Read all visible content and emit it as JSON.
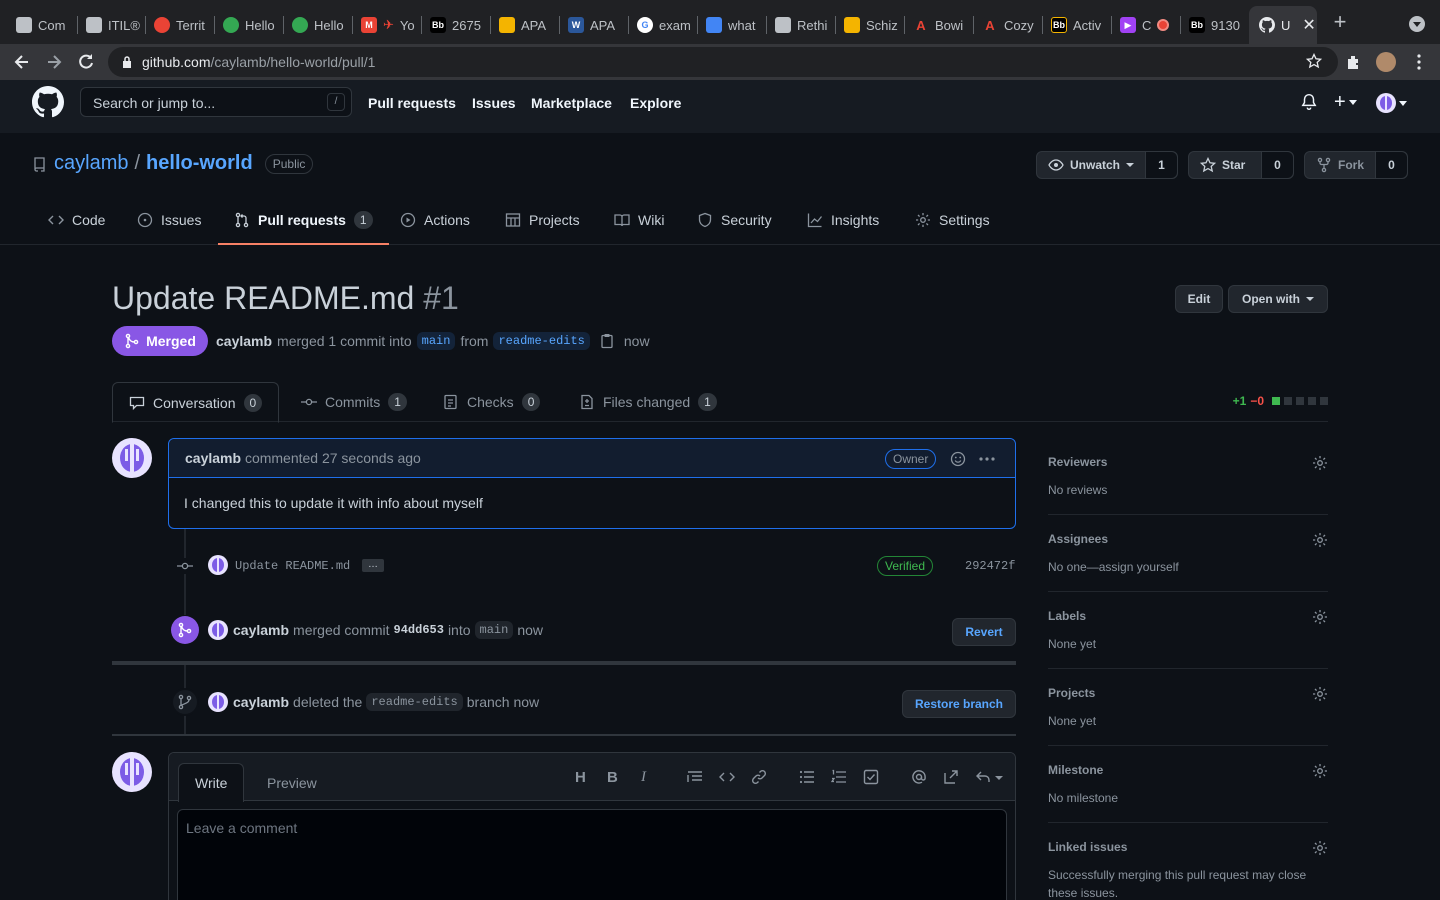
{
  "browser": {
    "tabs": [
      {
        "label": "Com",
        "icon": "github-icon",
        "color": "#bdc1c6"
      },
      {
        "label": "ITIL®",
        "icon": "github-icon",
        "color": "#bdc1c6"
      },
      {
        "label": "Territ",
        "icon": "red-circle-icon",
        "color": "#ea4335"
      },
      {
        "label": "Hello",
        "icon": "green-leaf-icon",
        "color": "#34a853"
      },
      {
        "label": "Hello",
        "icon": "green-leaf-icon",
        "color": "#34a853"
      },
      {
        "label": "Yo",
        "icon": "gmail-icon",
        "color": "#ea4335"
      },
      {
        "label": "2675",
        "icon": "blackboard-icon",
        "color": "#000000"
      },
      {
        "label": "APA",
        "icon": "apa-icon",
        "color": "#f4b400"
      },
      {
        "label": "APA",
        "icon": "word-icon",
        "color": "#2b579a"
      },
      {
        "label": "exam",
        "icon": "google-icon",
        "color": "#ffffff"
      },
      {
        "label": "what",
        "icon": "graduation-icon",
        "color": "#4285f4"
      },
      {
        "label": "Rethi",
        "icon": "github-icon",
        "color": "#bdc1c6"
      },
      {
        "label": "Schiz",
        "icon": "bookmark-icon",
        "color": "#f4b400"
      },
      {
        "label": "Bowi",
        "icon": "red-a-icon",
        "color": "#ea4335"
      },
      {
        "label": "Cozy",
        "icon": "red-a-icon",
        "color": "#ea4335"
      },
      {
        "label": "Activ",
        "icon": "blackboard-icon",
        "color": "#000000"
      },
      {
        "label": "C",
        "icon": "purple-play-icon",
        "color": "#a142f4"
      },
      {
        "label": "9130",
        "icon": "blackboard-icon",
        "color": "#000000"
      },
      {
        "label": "U",
        "icon": "github-icon",
        "color": "#e8eaed"
      }
    ],
    "url_host": "github.com",
    "url_path": "/caylamb/hello-world/pull/1"
  },
  "header": {
    "search_placeholder": "Search or jump to...",
    "search_key": "/",
    "nav": [
      "Pull requests",
      "Issues",
      "Marketplace",
      "Explore"
    ]
  },
  "repo": {
    "owner": "caylamb",
    "sep": "/",
    "name": "hello-world",
    "visibility": "Public",
    "unwatch_label": "Unwatch",
    "unwatch_count": "1",
    "star_label": "Star",
    "star_count": "0",
    "fork_label": "Fork",
    "fork_count": "0",
    "tabs": [
      {
        "label": "Code",
        "icon": "code-icon"
      },
      {
        "label": "Issues",
        "icon": "issue-icon"
      },
      {
        "label": "Pull requests",
        "icon": "pull-request-icon",
        "count": "1"
      },
      {
        "label": "Actions",
        "icon": "play-icon"
      },
      {
        "label": "Projects",
        "icon": "table-icon"
      },
      {
        "label": "Wiki",
        "icon": "book-icon"
      },
      {
        "label": "Security",
        "icon": "shield-icon"
      },
      {
        "label": "Insights",
        "icon": "graph-icon"
      },
      {
        "label": "Settings",
        "icon": "gear-icon"
      }
    ]
  },
  "pr": {
    "title": "Update README.md",
    "number": "#1",
    "edit_label": "Edit",
    "open_with_label": "Open with",
    "state": "Merged",
    "author": "caylamb",
    "merge_text": "merged 1 commit into",
    "base": "main",
    "from_text": "from",
    "head": "readme-edits",
    "time": "now",
    "tabs": [
      {
        "label": "Conversation",
        "count": "0",
        "icon": "comment-icon"
      },
      {
        "label": "Commits",
        "count": "1",
        "icon": "commit-icon"
      },
      {
        "label": "Checks",
        "count": "0",
        "icon": "checklist-icon"
      },
      {
        "label": "Files changed",
        "count": "1",
        "icon": "file-diff-icon"
      }
    ],
    "additions": "+1",
    "deletions": "−0",
    "diff_colors": [
      "#3fb950",
      "#30363d",
      "#30363d",
      "#30363d",
      "#30363d"
    ]
  },
  "comment": {
    "author": "caylamb",
    "action": "commented 27 seconds ago",
    "badge": "Owner",
    "body": "I changed this to update it with info about myself"
  },
  "commit": {
    "message": "Update README.md",
    "ellipsis": "…",
    "verified": "Verified",
    "sha": "292472f"
  },
  "merge_event": {
    "actor": "caylamb",
    "text": "merged commit",
    "sha": "94dd653",
    "into": "into",
    "branch": "main",
    "time": "now",
    "revert_label": "Revert"
  },
  "delete_event": {
    "actor": "caylamb",
    "text": "deleted the",
    "branch": "readme-edits",
    "suffix": "branch now",
    "restore_label": "Restore branch"
  },
  "new_comment": {
    "write_tab": "Write",
    "preview_tab": "Preview",
    "placeholder": "Leave a comment"
  },
  "sidebar": [
    {
      "heading": "Reviewers",
      "value": "No reviews"
    },
    {
      "heading": "Assignees",
      "value": "No one—assign yourself"
    },
    {
      "heading": "Labels",
      "value": "None yet"
    },
    {
      "heading": "Projects",
      "value": "None yet"
    },
    {
      "heading": "Milestone",
      "value": "No milestone"
    },
    {
      "heading": "Linked issues",
      "value": "Successfully merging this pull request may close these issues."
    }
  ]
}
